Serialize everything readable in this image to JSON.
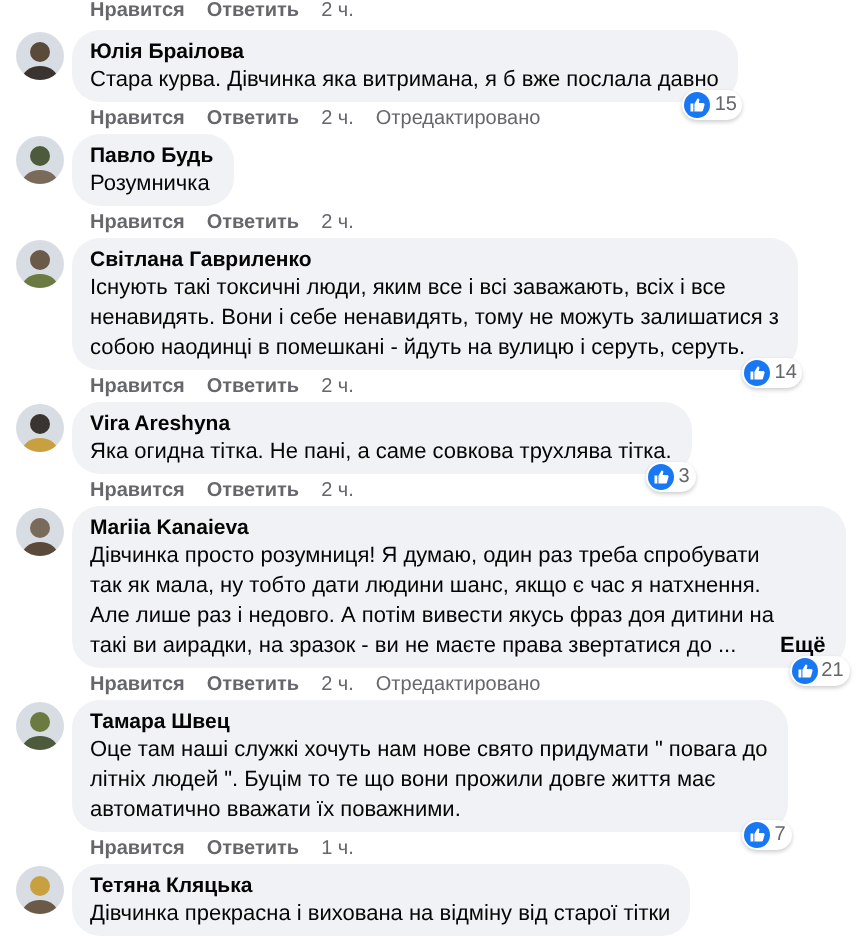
{
  "top_actions": {
    "like": "Нравится",
    "reply": "Ответить",
    "time": "2 ч."
  },
  "comments": [
    {
      "author": "Юлія Браілова",
      "lines": [
        "Стара курва. Дівчинка яка витримана, я б вже послала давно"
      ],
      "like": "Нравится",
      "reply": "Ответить",
      "time": "2 ч.",
      "edited": "Отредактировано",
      "reactions": "15"
    },
    {
      "author": "Павло Будь",
      "lines": [
        "Розумничка"
      ],
      "like": "Нравится",
      "reply": "Ответить",
      "time": "2 ч."
    },
    {
      "author": "Світлана Гавриленко",
      "lines": [
        "Існують такі токсичні люди, яким все і всі заважають, всіх і все",
        "ненавидять. Вони і себе ненавидять, тому не можуть залишатися з",
        "собою наодинці в помешкані - йдуть на вулицю і серуть, серуть."
      ],
      "like": "Нравится",
      "reply": "Ответить",
      "time": "2 ч.",
      "reactions": "14"
    },
    {
      "author": "Vira Areshyna",
      "lines": [
        "Яка огидна тітка. Не пані, а саме совкова трухлява тітка."
      ],
      "like": "Нравится",
      "reply": "Ответить",
      "time": "2 ч.",
      "reactions": "3"
    },
    {
      "author": "Mariia Kanaieva",
      "lines": [
        "Дівчинка просто розумниця! Я думаю, один раз треба спробувати",
        "так як мала, ну тобто дати людини шанс, якщо є час я натхнення.",
        "Але лише раз і недовго. А потім вивести якусь фраз доя дитини на",
        "такі ви аирадки, на зразок - ви не маєте права звертатися до ..."
      ],
      "more": "Ещё",
      "like": "Нравится",
      "reply": "Ответить",
      "time": "2 ч.",
      "edited": "Отредактировано",
      "reactions": "21"
    },
    {
      "author": "Тамара Швец",
      "lines": [
        "Оце там наші служкі хочуть нам нове свято придумати \" повага до",
        "літніх людей \". Буцім то те що вони прожили довге життя має",
        "автоматично вважати їх поважними."
      ],
      "like": "Нравится",
      "reply": "Ответить",
      "time": "1 ч.",
      "reactions": "7"
    },
    {
      "author": "Тетяна Кляцька",
      "lines": [
        "Дівчинка прекрасна і вихована на відміну від старої тітки"
      ]
    }
  ]
}
